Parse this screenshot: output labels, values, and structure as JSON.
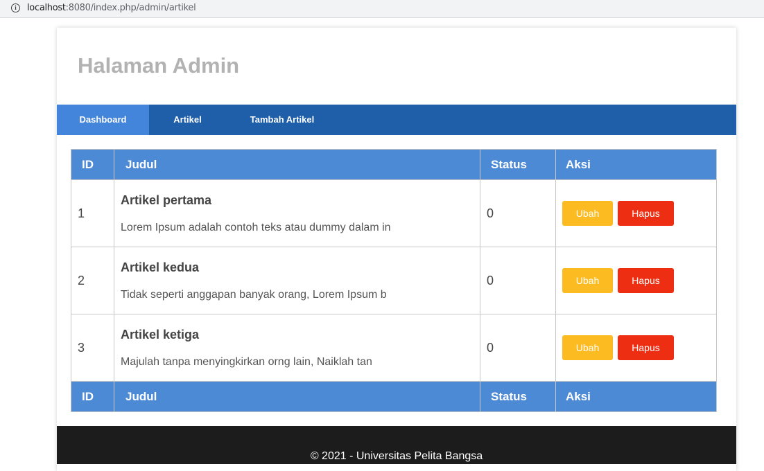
{
  "browser": {
    "url_host": "localhost",
    "url_rest": ":8080/index.php/admin/artikel"
  },
  "header": {
    "title": "Halaman Admin"
  },
  "nav": {
    "items": [
      {
        "label": "Dashboard",
        "active": true
      },
      {
        "label": "Artikel",
        "active": false
      },
      {
        "label": "Tambah Artikel",
        "active": false
      }
    ]
  },
  "table": {
    "headers": {
      "id": "ID",
      "judul": "Judul",
      "status": "Status",
      "aksi": "Aksi"
    },
    "rows": [
      {
        "id": "1",
        "title": "Artikel pertama",
        "excerpt": "Lorem Ipsum adalah contoh teks atau dummy dalam in",
        "status": "0",
        "edit": "Ubah",
        "delete": "Hapus"
      },
      {
        "id": "2",
        "title": "Artikel kedua",
        "excerpt": "Tidak seperti anggapan banyak orang, Lorem Ipsum b",
        "status": "0",
        "edit": "Ubah",
        "delete": "Hapus"
      },
      {
        "id": "3",
        "title": "Artikel ketiga",
        "excerpt": "Majulah tanpa menyingkirkan orng lain, Naiklah tan",
        "status": "0",
        "edit": "Ubah",
        "delete": "Hapus"
      }
    ]
  },
  "footer": {
    "text": "© 2021 - Universitas Pelita Bangsa"
  },
  "colors": {
    "nav_bg": "#1f5faa",
    "nav_active": "#4285db",
    "table_header": "#4d8ad5",
    "edit_button": "#fbbb21",
    "delete_button": "#ee2e12",
    "footer_bg": "#1c1c1c",
    "title_text": "#b2b2b2"
  }
}
